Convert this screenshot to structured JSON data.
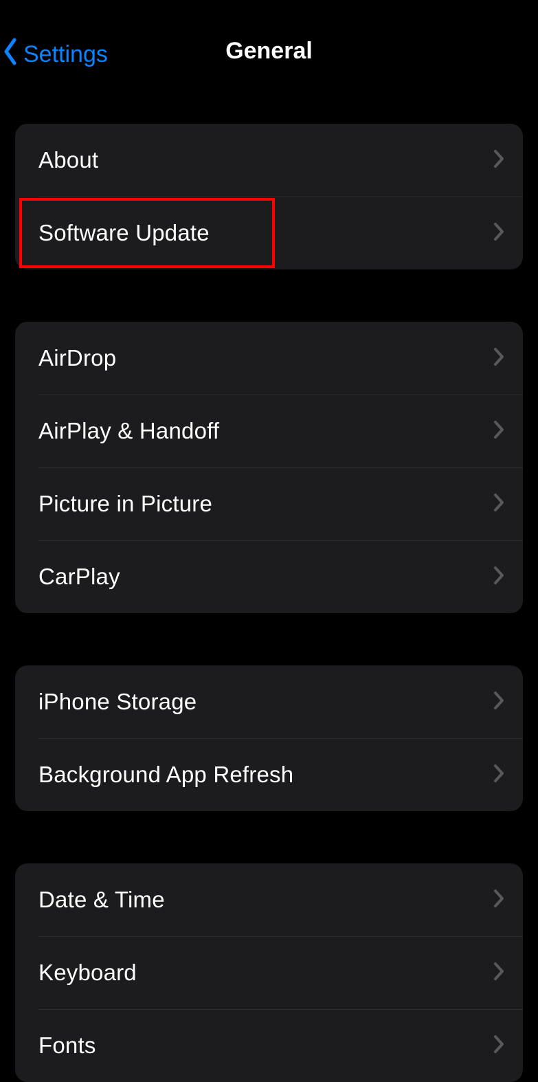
{
  "header": {
    "back_label": "Settings",
    "title": "General"
  },
  "groups": [
    {
      "items": [
        {
          "id": "about",
          "label": "About"
        },
        {
          "id": "software-update",
          "label": "Software Update"
        }
      ]
    },
    {
      "items": [
        {
          "id": "airdrop",
          "label": "AirDrop"
        },
        {
          "id": "airplay-handoff",
          "label": "AirPlay & Handoff"
        },
        {
          "id": "picture-in-picture",
          "label": "Picture in Picture"
        },
        {
          "id": "carplay",
          "label": "CarPlay"
        }
      ]
    },
    {
      "items": [
        {
          "id": "iphone-storage",
          "label": "iPhone Storage"
        },
        {
          "id": "background-app-refresh",
          "label": "Background App Refresh"
        }
      ]
    },
    {
      "items": [
        {
          "id": "date-time",
          "label": "Date & Time"
        },
        {
          "id": "keyboard",
          "label": "Keyboard"
        },
        {
          "id": "fonts",
          "label": "Fonts"
        }
      ]
    }
  ],
  "highlight": {
    "target_row_id": "software-update"
  }
}
